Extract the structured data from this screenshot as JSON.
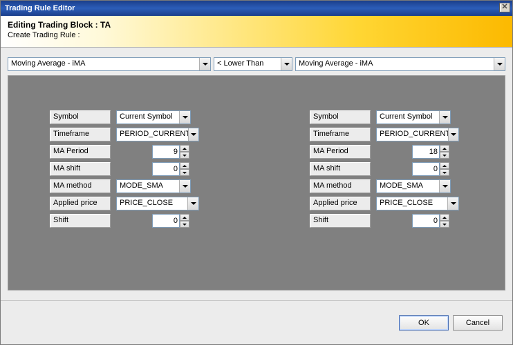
{
  "window": {
    "title": "Trading Rule Editor"
  },
  "banner": {
    "title": "Editing Trading Block : TA",
    "subtitle": "Create Trading Rule :"
  },
  "selectors": {
    "left": "Moving Average - iMA",
    "op": "< Lower Than",
    "right": "Moving Average - iMA"
  },
  "labels": {
    "symbol": "Symbol",
    "timeframe": "Timeframe",
    "ma_period": "MA Period",
    "ma_shift": "MA shift",
    "ma_method": "MA method",
    "applied_price": "Applied price",
    "shift": "Shift"
  },
  "left": {
    "symbol": "Current Symbol",
    "timeframe": "PERIOD_CURRENT",
    "ma_period": "9",
    "ma_shift": "0",
    "ma_method": "MODE_SMA",
    "applied_price": "PRICE_CLOSE",
    "shift": "0"
  },
  "right": {
    "symbol": "Current Symbol",
    "timeframe": "PERIOD_CURRENT",
    "ma_period": "18",
    "ma_shift": "0",
    "ma_method": "MODE_SMA",
    "applied_price": "PRICE_CLOSE",
    "shift": "0"
  },
  "buttons": {
    "ok": "OK",
    "cancel": "Cancel"
  }
}
